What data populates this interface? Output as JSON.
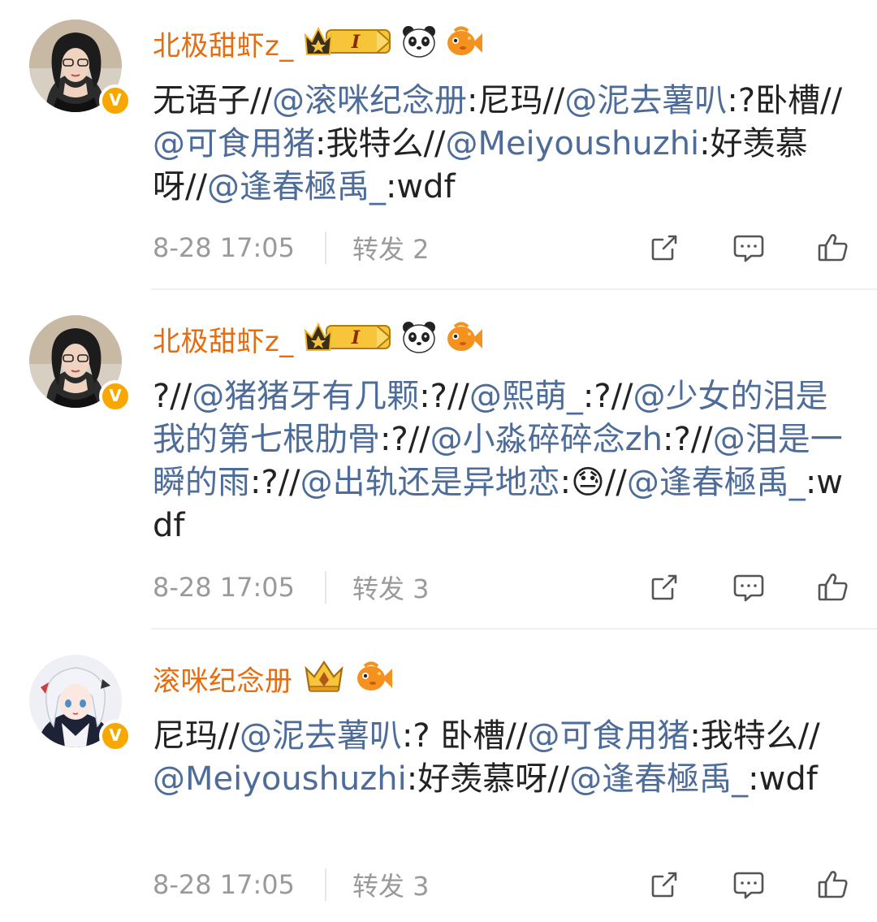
{
  "comments": [
    {
      "username": "北极甜虾z_",
      "segments": [
        {
          "t": "无语子//",
          "m": false
        },
        {
          "t": "@滚咪纪念册",
          "m": true
        },
        {
          "t": ":尼玛//",
          "m": false
        },
        {
          "t": "@泥去薯叭",
          "m": true
        },
        {
          "t": ":?卧槽//",
          "m": false
        },
        {
          "t": "@可食用猪",
          "m": true
        },
        {
          "t": ":我特么//",
          "m": false
        },
        {
          "t": "@Meiyoushuzhi",
          "m": true
        },
        {
          "t": ":好羡慕呀//",
          "m": false
        },
        {
          "t": "@逢春極禹_",
          "m": true
        },
        {
          "t": ":wdf",
          "m": false
        }
      ],
      "time": "8-28 17:05",
      "repost": "转发 2"
    },
    {
      "username": "北极甜虾z_",
      "segments": [
        {
          "t": "?//",
          "m": false
        },
        {
          "t": "@猪猪牙有几颗",
          "m": true
        },
        {
          "t": ":?//",
          "m": false
        },
        {
          "t": "@熙萌_",
          "m": true
        },
        {
          "t": ":?//",
          "m": false
        },
        {
          "t": "@少女的泪是我的第七根肋骨",
          "m": true
        },
        {
          "t": ":?//",
          "m": false
        },
        {
          "t": "@小淼碎碎念zh",
          "m": true
        },
        {
          "t": ":?//",
          "m": false
        },
        {
          "t": "@泪是一瞬的雨",
          "m": true
        },
        {
          "t": ":?//",
          "m": false
        },
        {
          "t": "@出轨还是异地恋",
          "m": true
        },
        {
          "t": ":😓//",
          "m": false
        },
        {
          "t": "@逢春極禹_",
          "m": true
        },
        {
          "t": ":wdf",
          "m": false
        }
      ],
      "time": "8-28 17:05",
      "repost": "转发 3"
    },
    {
      "username": "滚咪纪念册",
      "segments": [
        {
          "t": "尼玛//",
          "m": false
        },
        {
          "t": "@泥去薯叭",
          "m": true
        },
        {
          "t": ":? 卧槽//",
          "m": false
        },
        {
          "t": "@可食用猪",
          "m": true
        },
        {
          "t": ":我特么//",
          "m": false
        },
        {
          "t": "@Meiyoushuzhi",
          "m": true
        },
        {
          "t": ":好羡慕呀//",
          "m": false
        },
        {
          "t": "@逢春極禹_",
          "m": true
        },
        {
          "t": ":wdf",
          "m": false
        }
      ],
      "time": "8-28 17:05",
      "repost": "转发 3"
    }
  ],
  "icons": {
    "share": "share-icon",
    "comment": "comment-icon",
    "like": "thumbs-up-icon",
    "verified": "verified-v-icon",
    "crown": "crown-badge-icon",
    "panda": "panda-icon",
    "fish": "fish-icon"
  },
  "colors": {
    "username": "#e86b0c",
    "mention": "#4d6c99",
    "meta": "#9a9a9a",
    "verified": "#f8a700"
  },
  "verified_letter": "V",
  "crown_level": "I"
}
